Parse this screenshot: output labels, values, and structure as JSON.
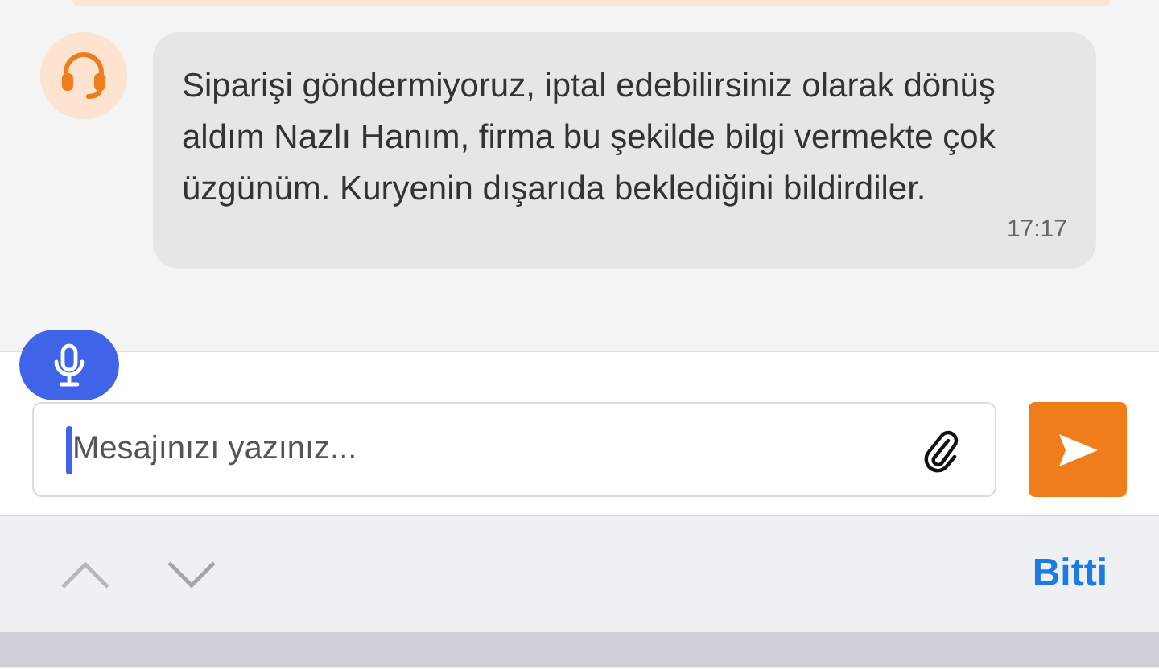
{
  "message": {
    "text": "Siparişi göndermiyoruz, iptal edebilirsiniz olarak dönüş aldım Nazlı Hanım, firma bu şekilde bilgi vermekte çok üzgünüm. Kuryenin dışarıda beklediğini bildirdiler.",
    "time": "17:17"
  },
  "composer": {
    "placeholder": "Mesajınızı yazınız..."
  },
  "keyboard_bar": {
    "done": "Bitti"
  }
}
